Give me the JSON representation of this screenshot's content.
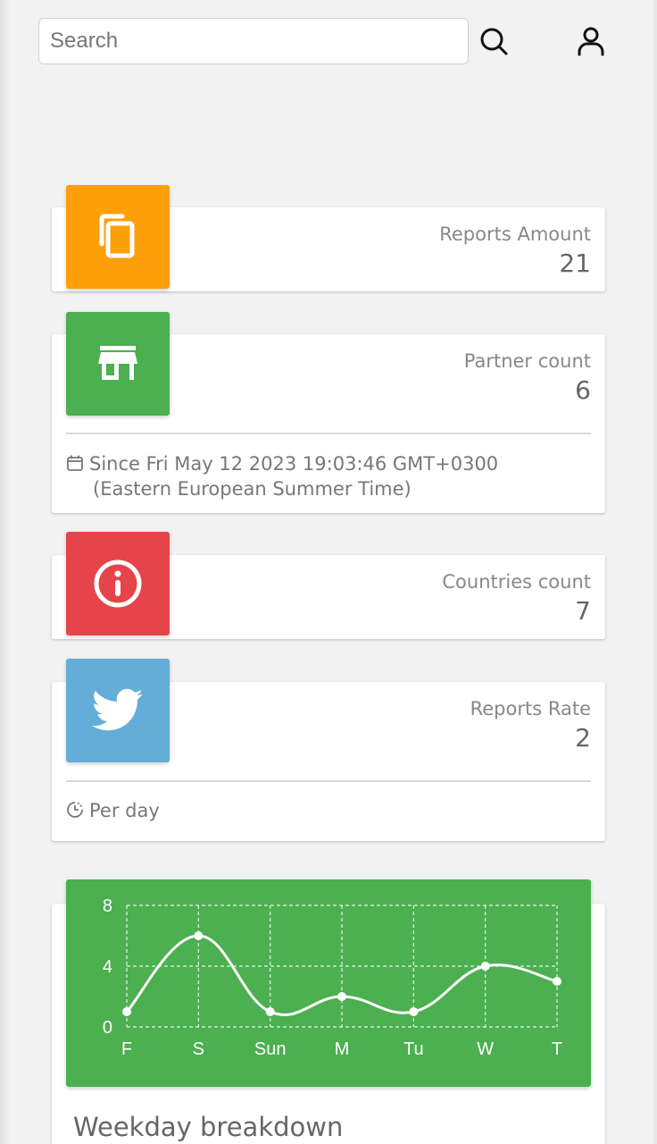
{
  "search": {
    "placeholder": "Search",
    "value": ""
  },
  "header": {
    "search_icon": "search-icon",
    "user_icon": "user-icon"
  },
  "cards": [
    {
      "title": "Reports Amount",
      "value": "21",
      "icon": "copy-icon",
      "color": "#ff9f0a"
    },
    {
      "title": "Partner count",
      "value": "6",
      "icon": "store-icon",
      "color": "#4caf50",
      "footer": {
        "icon": "calendar-icon",
        "line1": "Since Fri May 12 2023 19:03:46 GMT+0300",
        "line2": "(Eastern European Summer Time)"
      }
    },
    {
      "title": "Countries count",
      "value": "7",
      "icon": "info-icon",
      "color": "#e5454a"
    },
    {
      "title": "Reports Rate",
      "value": "2",
      "icon": "twitter-icon",
      "color": "#64add8",
      "footer": {
        "icon": "clock-icon",
        "line1": "Per day"
      }
    }
  ],
  "chart_title": "Weekday breakdown",
  "chart_data": {
    "type": "line",
    "categories": [
      "F",
      "S",
      "Sun",
      "M",
      "Tu",
      "W",
      "T"
    ],
    "values": [
      1,
      6,
      1,
      2,
      1,
      4,
      3
    ],
    "yticks": [
      "0",
      "4",
      "8"
    ],
    "ylim": [
      0,
      8
    ],
    "grid": true,
    "background": "#4caf50",
    "line_color": "#ffffff"
  }
}
